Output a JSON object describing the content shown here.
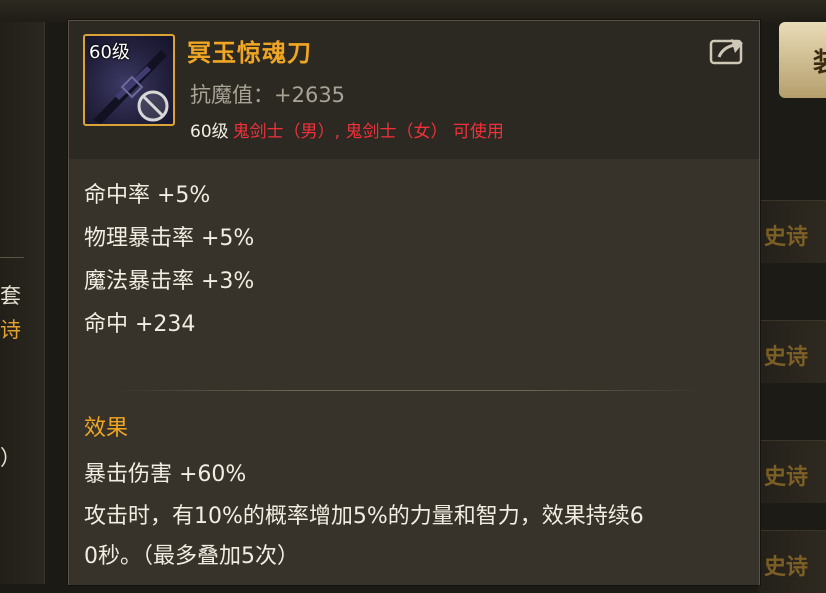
{
  "colors": {
    "item_name": "#f0a623",
    "section_title": "#f0a623",
    "restriction_text": "#f2303a",
    "body_text": "#f1ede2",
    "muted_text": "#a9a396",
    "icon_border": "#d9a336",
    "panel_bg": "#37332a"
  },
  "background": {
    "left_panel": {
      "line1": "套",
      "line2": "诗",
      "line3": "）"
    },
    "right_panel": {
      "button_label": "装",
      "rows": [
        "史诗",
        "史诗",
        "史诗",
        "史诗"
      ]
    }
  },
  "item": {
    "icon": "ghost-sword-icon",
    "level_badge": "60级",
    "name": "冥玉惊魂刀",
    "resistance": "抗魔值：+2635",
    "requirement_level": "60级",
    "requirement_classes": "鬼剑士（男）, 鬼剑士（女） 可使用"
  },
  "attributes": [
    "命中率 +5%",
    "物理暴击率 +5%",
    "魔法暴击率 +3%",
    "命中 +234"
  ],
  "effect": {
    "title": "效果",
    "lines": [
      "暴击伤害 +60%",
      "攻击时，有10%的概率增加5%的力量和智力，效果持续6",
      "0秒。（最多叠加5次）"
    ]
  }
}
